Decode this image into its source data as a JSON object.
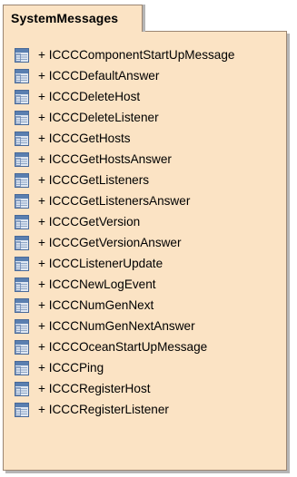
{
  "package": {
    "name": "SystemMessages"
  },
  "classes": [
    {
      "visibility": "+",
      "name": "ICCCComponentStartUpMessage",
      "icon": "class-icon"
    },
    {
      "visibility": "+",
      "name": "ICCCDefaultAnswer",
      "icon": "class-icon"
    },
    {
      "visibility": "+",
      "name": "ICCCDeleteHost",
      "icon": "class-icon"
    },
    {
      "visibility": "+",
      "name": "ICCCDeleteListener",
      "icon": "class-icon"
    },
    {
      "visibility": "+",
      "name": "ICCCGetHosts",
      "icon": "class-icon"
    },
    {
      "visibility": "+",
      "name": "ICCCGetHostsAnswer",
      "icon": "class-icon"
    },
    {
      "visibility": "+",
      "name": "ICCCGetListeners",
      "icon": "class-icon"
    },
    {
      "visibility": "+",
      "name": "ICCCGetListenersAnswer",
      "icon": "class-icon"
    },
    {
      "visibility": "+",
      "name": "ICCCGetVersion",
      "icon": "class-icon"
    },
    {
      "visibility": "+",
      "name": "ICCCGetVersionAnswer",
      "icon": "class-icon"
    },
    {
      "visibility": "+",
      "name": "ICCCListenerUpdate",
      "icon": "class-icon"
    },
    {
      "visibility": "+",
      "name": "ICCCNewLogEvent",
      "icon": "class-icon"
    },
    {
      "visibility": "+",
      "name": "ICCCNumGenNext",
      "icon": "class-icon"
    },
    {
      "visibility": "+",
      "name": "ICCCNumGenNextAnswer",
      "icon": "class-icon"
    },
    {
      "visibility": "+",
      "name": "ICCCOceanStartUpMessage",
      "icon": "class-icon"
    },
    {
      "visibility": "+",
      "name": "ICCCPing",
      "icon": "class-icon"
    },
    {
      "visibility": "+",
      "name": "ICCCRegisterHost",
      "icon": "class-icon"
    },
    {
      "visibility": "+",
      "name": "ICCCRegisterListener",
      "icon": "class-icon"
    }
  ],
  "colors": {
    "package_fill": "#fbe3c4",
    "package_border": "#9b8672",
    "shadow": "#b5b5b5",
    "icon_header": "#5a7fb0",
    "icon_body": "#dfe7f2"
  }
}
